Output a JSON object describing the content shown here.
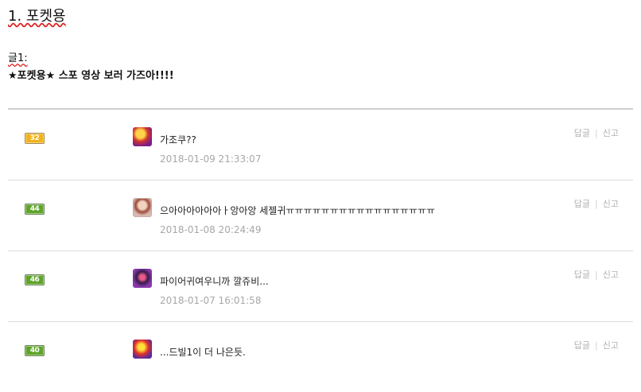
{
  "page": {
    "title": "1. 포켓용",
    "post_label": "글1:",
    "post_title": "★포켓용★ 스포 영상 보러 가즈아!!!!"
  },
  "actions": {
    "reply": "답글",
    "report": "신고",
    "separator": "|"
  },
  "comments": [
    {
      "level": "32",
      "level_color": "#f2b21a",
      "text": "가조쿠??",
      "date": "2018-01-09 21:33:07"
    },
    {
      "level": "44",
      "level_color": "#5fa42b",
      "text": "으아아아아아아ㅏ앙아앙 세젤귀ㅠㅠㅠㅠㅠㅠㅠㅠㅠㅠㅠㅠㅠㅠㅠㅠㅠ",
      "date": "2018-01-08 20:24:49"
    },
    {
      "level": "46",
      "level_color": "#5fa42b",
      "text": "파이어귀여우니까 깔쥬비...",
      "date": "2018-01-07 16:01:58"
    },
    {
      "level": "40",
      "level_color": "#5fa42b",
      "text": "...드빌1이 더 나은듯.",
      "date": ""
    }
  ]
}
